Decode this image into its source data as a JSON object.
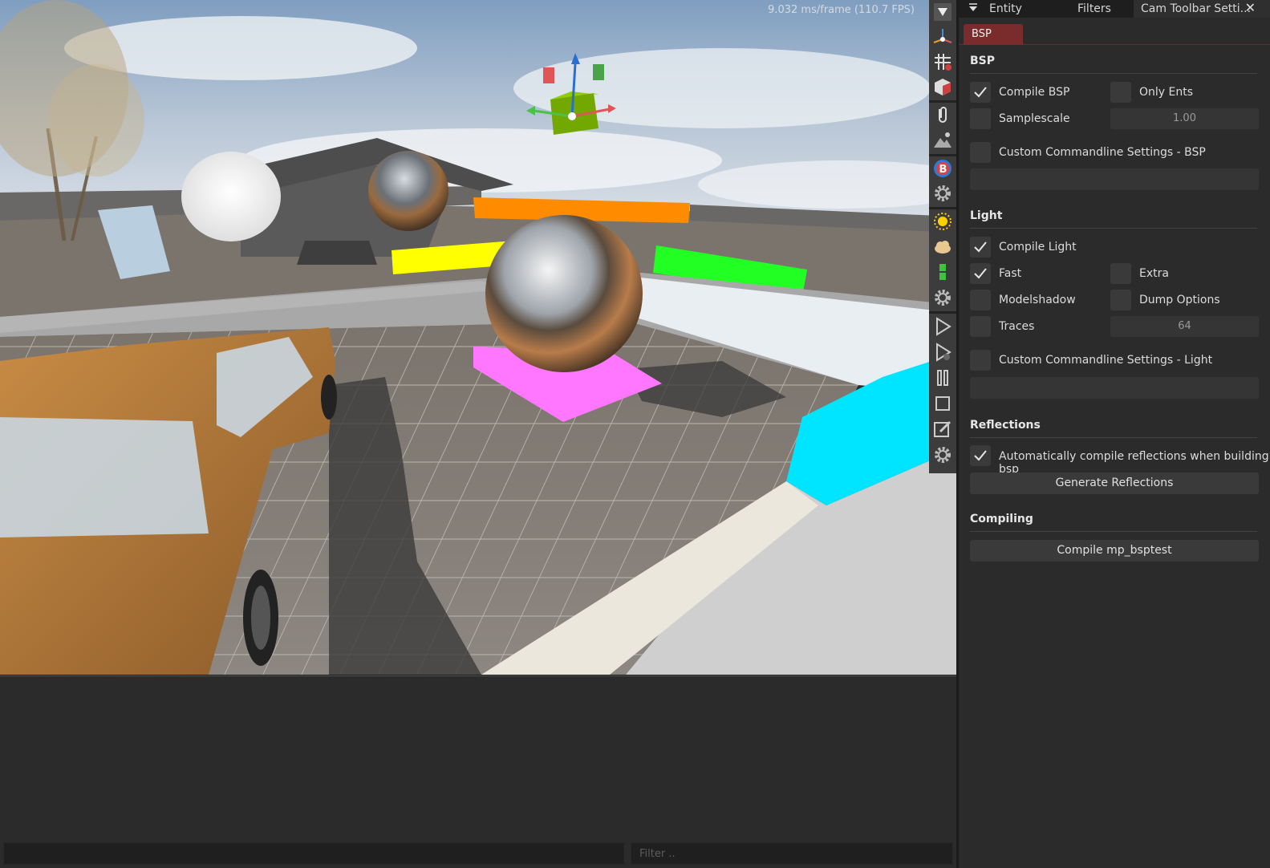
{
  "viewport": {
    "fps_text": "9.032 ms/frame (110.7 FPS)",
    "toolbar_icons": [
      "filter-dropdown-icon",
      "transform-gizmo-icon",
      "grid-snap-icon",
      "view-cube-icon",
      "attach-icon",
      "terrain-icon",
      "bsp-icon",
      "settings-icon",
      "sun-icon",
      "cloud-icon",
      "green-light-icon",
      "settings-icon",
      "play-icon",
      "play-outline-icon",
      "pause-icon",
      "stop-icon",
      "edit-icon",
      "settings-icon"
    ]
  },
  "console": {
    "command_value": "",
    "filter_placeholder": "Filter .."
  },
  "panel": {
    "tabs": [
      {
        "label": "Entity"
      },
      {
        "label": "Filters"
      },
      {
        "label": "Cam Toolbar Setti..."
      }
    ],
    "close_label": "✕",
    "subtab": "BSP",
    "bsp": {
      "title": "BSP",
      "compile_bsp": {
        "label": "Compile BSP",
        "checked": true
      },
      "only_ents": {
        "label": "Only Ents",
        "checked": false
      },
      "samplescale": {
        "label": "Samplescale",
        "checked": false,
        "value": "1.00"
      },
      "custom": {
        "label": "Custom Commandline Settings - BSP",
        "checked": false,
        "value": ""
      }
    },
    "light": {
      "title": "Light",
      "compile_light": {
        "label": "Compile Light",
        "checked": true
      },
      "fast": {
        "label": "Fast",
        "checked": true
      },
      "extra": {
        "label": "Extra",
        "checked": false
      },
      "modelshadow": {
        "label": "Modelshadow",
        "checked": false
      },
      "dump_options": {
        "label": "Dump Options",
        "checked": false
      },
      "traces": {
        "label": "Traces",
        "checked": false,
        "value": "64"
      },
      "custom": {
        "label": "Custom Commandline Settings - Light",
        "checked": false,
        "value": ""
      }
    },
    "reflections": {
      "title": "Reflections",
      "auto": {
        "label": "Automatically compile reflections when building bsp",
        "checked": true
      },
      "generate_label": "Generate Reflections"
    },
    "compiling": {
      "title": "Compiling",
      "compile_label": "Compile mp_bsptest"
    }
  },
  "colors": {
    "panel_bg": "#2b2b2b",
    "accent_red": "#7a2b2b",
    "orange": "#ff8c00",
    "yellow": "#ffff00",
    "green": "#22ff22",
    "magenta": "#ff77ff",
    "cyan": "#00e5ff"
  }
}
